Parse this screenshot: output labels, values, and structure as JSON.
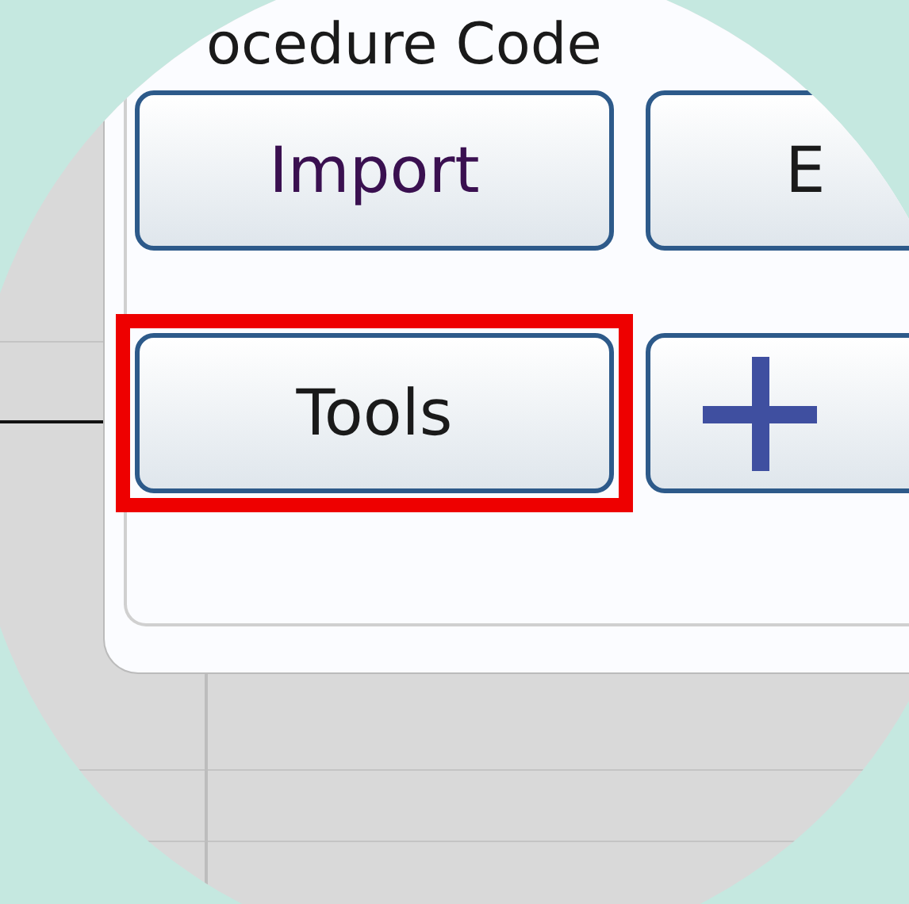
{
  "header": {
    "text": "ocedure Code"
  },
  "buttons": [
    {
      "kind": "text",
      "label": "Import",
      "highlighted": false
    },
    {
      "kind": "text",
      "label": "E",
      "highlighted": false
    },
    {
      "kind": "text",
      "label": "Tools",
      "highlighted": true
    },
    {
      "kind": "plus",
      "highlighted": false
    }
  ]
}
